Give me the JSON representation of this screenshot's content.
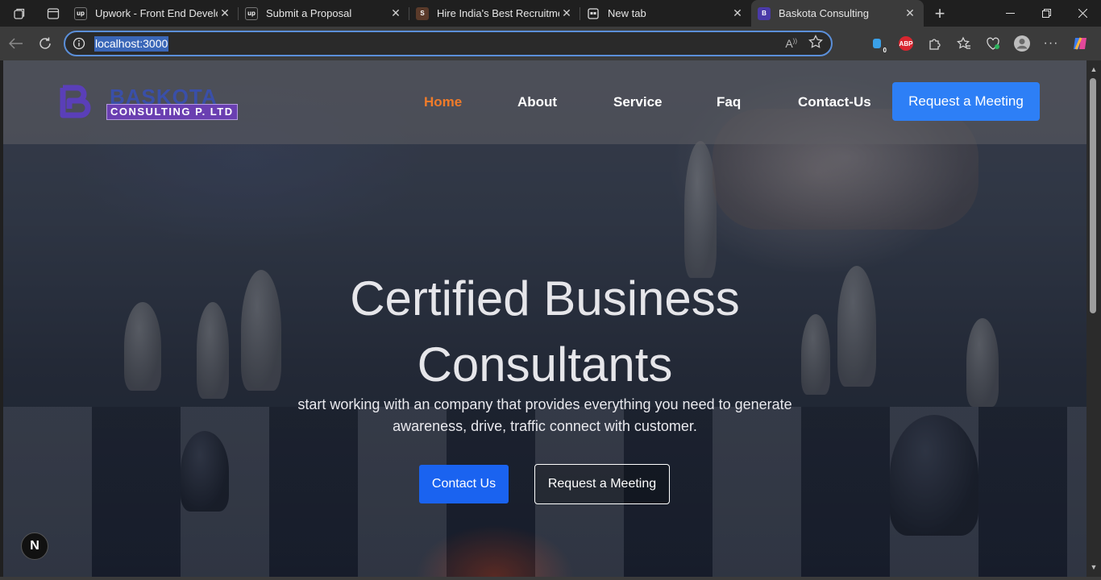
{
  "browser": {
    "tabs": [
      {
        "title": "Upwork - Front End Develop",
        "favicon": "up"
      },
      {
        "title": "Submit a Proposal",
        "favicon": "up"
      },
      {
        "title": "Hire India's Best Recruitment",
        "favicon": "S"
      },
      {
        "title": "New tab",
        "favicon": "newtab-icon"
      },
      {
        "title": "Baskota Consulting",
        "favicon": "B"
      }
    ],
    "url": "localhost:3000",
    "extensions": {
      "abp_label": "ABP",
      "badge_count": "0"
    }
  },
  "site": {
    "logo": {
      "top": "BASKOTA",
      "bottom": "CONSULTING P. LTD"
    },
    "nav": [
      "Home",
      "About",
      "Service",
      "Faq",
      "Contact-Us"
    ],
    "nav_active": "Home",
    "header_cta": "Request a Meeting",
    "hero": {
      "title_line1": "Certified Business",
      "title_line2": "Consultants",
      "subtitle_line1": "start working with an company that provides everything you need to generate",
      "subtitle_line2": "awareness, drive, traffic connect with customer.",
      "primary_button": "Contact Us",
      "secondary_button": "Request a Meeting"
    },
    "dev_badge": "N"
  },
  "colors": {
    "accent": "#f07b2a",
    "cta": "#2d7ff6",
    "primary_button": "#1a63f0"
  }
}
